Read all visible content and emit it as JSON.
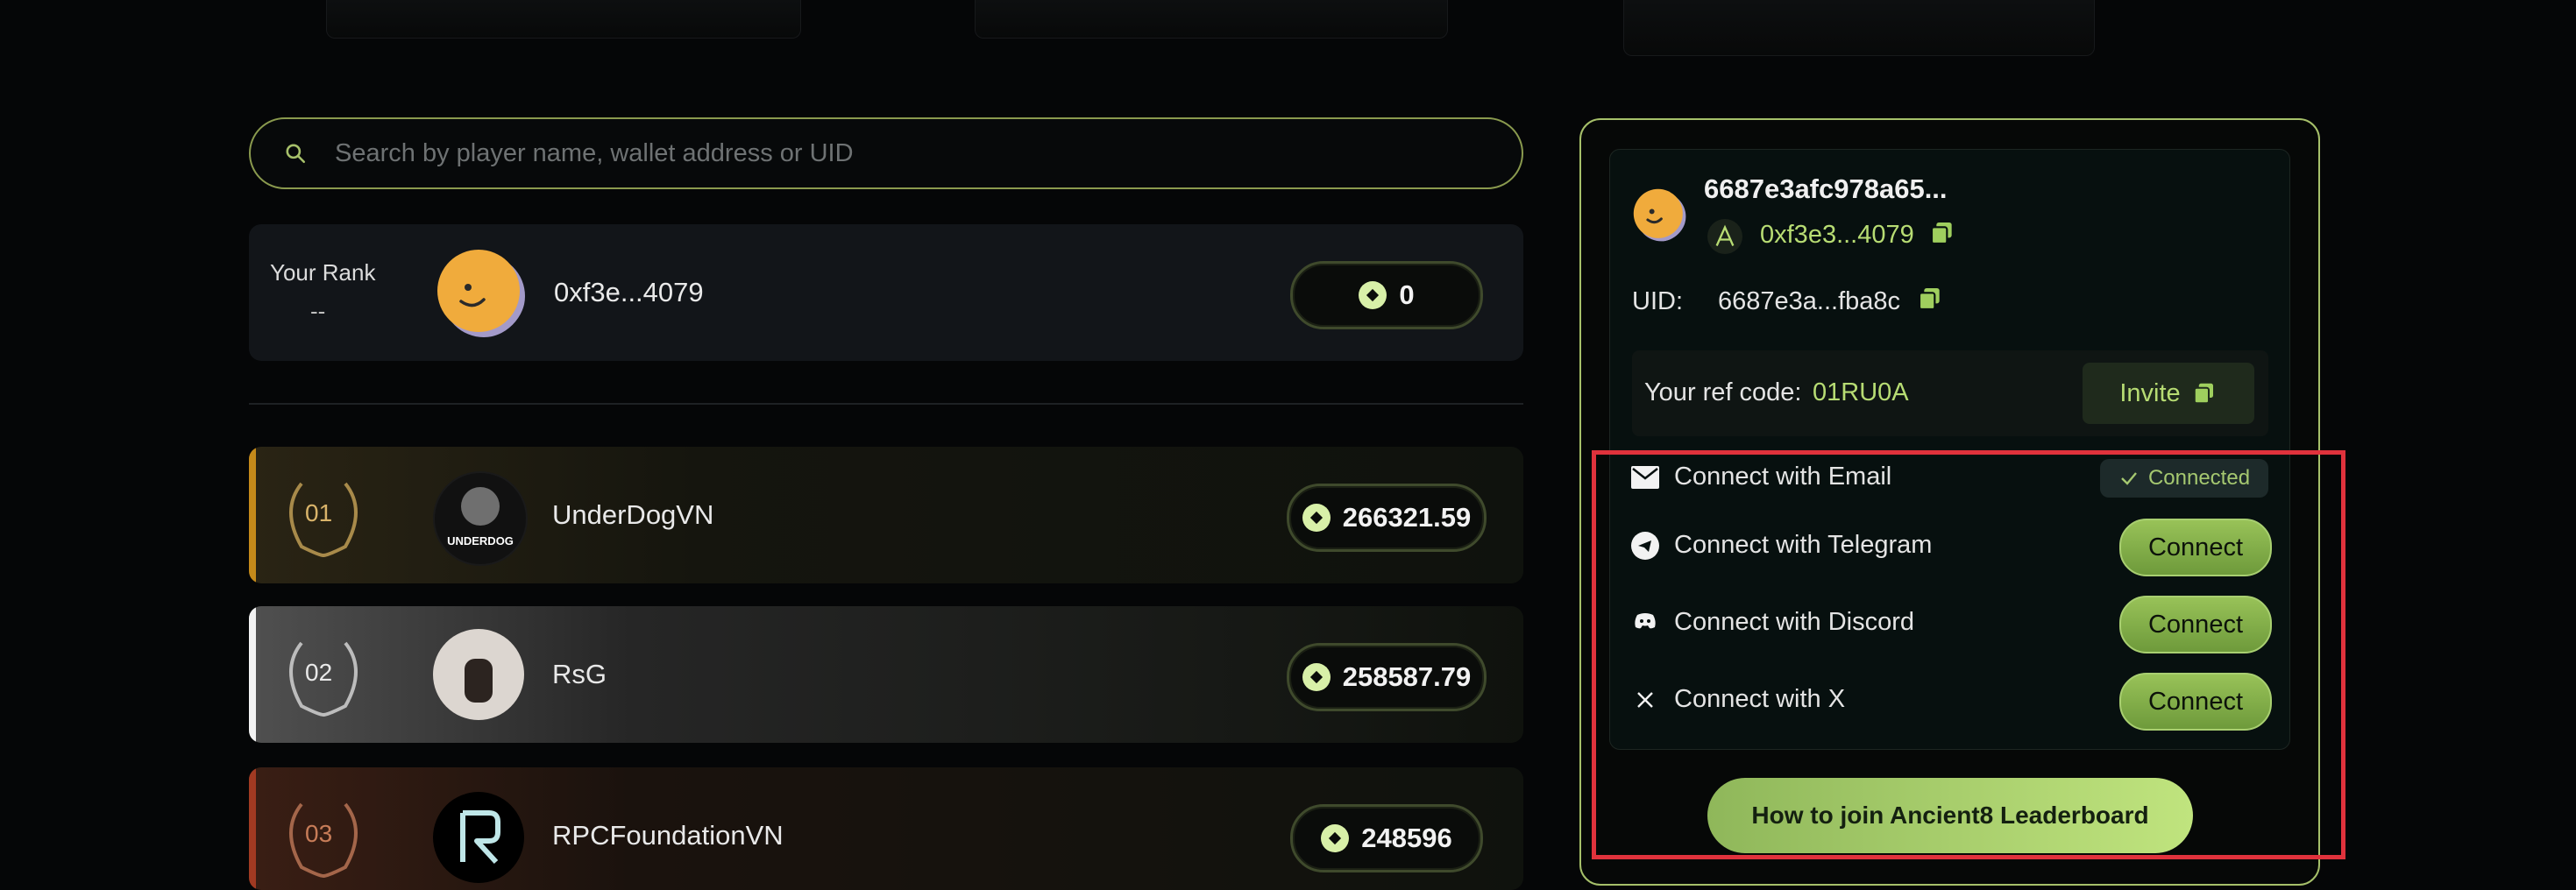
{
  "search": {
    "placeholder": "Search by player name, wallet address or UID"
  },
  "your_rank": {
    "label": "Your Rank",
    "value": "--",
    "name": "0xf3e...4079",
    "points": "0"
  },
  "leaderboard": [
    {
      "rank": "01",
      "name": "UnderDogVN",
      "points": "266321.59",
      "avatar_text": "UNDERDOG"
    },
    {
      "rank": "02",
      "name": "RsG",
      "points": "258587.79"
    },
    {
      "rank": "03",
      "name": "RPCFoundationVN",
      "points": "248596"
    }
  ],
  "profile": {
    "id": "6687e3afc978a65...",
    "wallet": "0xf3e3...4079",
    "uid_label": "UID:",
    "uid": "6687e3a...fba8c",
    "ref_label": "Your ref code:",
    "ref_code": "01RU0A",
    "invite_label": "Invite"
  },
  "connections": [
    {
      "label": "Connect with Email",
      "status": "Connected",
      "icon": "mail-icon"
    },
    {
      "label": "Connect with Telegram",
      "button": "Connect",
      "icon": "telegram-icon"
    },
    {
      "label": "Connect with Discord",
      "button": "Connect",
      "icon": "discord-icon"
    },
    {
      "label": "Connect with X",
      "button": "Connect",
      "icon": "x-icon"
    }
  ],
  "howto_label": "How to join Ancient8 Leaderboard",
  "colors": {
    "accent": "#b7dc73",
    "panel_border": "#a6c06a",
    "highlight": "#e0323c"
  }
}
